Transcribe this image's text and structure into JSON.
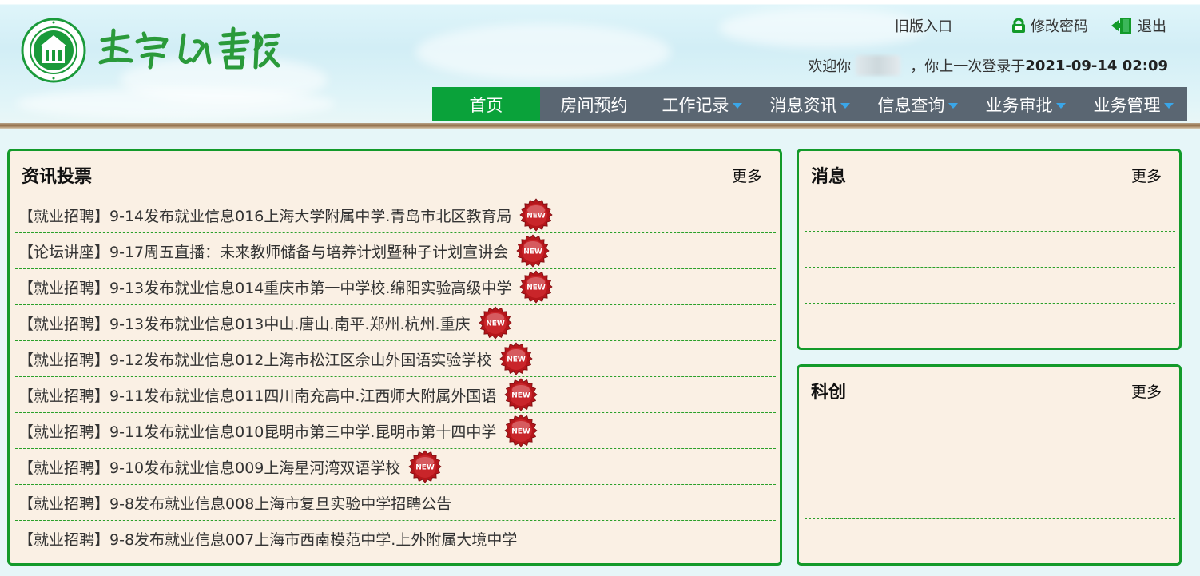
{
  "header": {
    "logo_emblem_text": "SHANGHAI NORMAL UNIVERSITY",
    "logo_title": "敬業樂群書院",
    "old_entry": "旧版入口",
    "change_password": "修改密码",
    "logout": "退出",
    "welcome_prefix": "欢迎你",
    "welcome_middle": "，你上一次登录于",
    "last_login": "2021-09-14 02:09"
  },
  "nav": {
    "items": [
      {
        "label": "首页",
        "active": true,
        "dropdown": false
      },
      {
        "label": "房间预约",
        "active": false,
        "dropdown": false
      },
      {
        "label": "工作记录",
        "active": false,
        "dropdown": true
      },
      {
        "label": "消息资讯",
        "active": false,
        "dropdown": true
      },
      {
        "label": "信息查询",
        "active": false,
        "dropdown": true
      },
      {
        "label": "业务审批",
        "active": false,
        "dropdown": true
      },
      {
        "label": "业务管理",
        "active": false,
        "dropdown": true
      }
    ]
  },
  "news_panel": {
    "title": "资讯投票",
    "more": "更多",
    "items": [
      {
        "text": "【就业招聘】9-14发布就业信息016上海大学附属中学.青岛市北区教育局",
        "is_new": true
      },
      {
        "text": "【论坛讲座】9-17周五直播：未来教师储备与培养计划暨种子计划宣讲会",
        "is_new": true
      },
      {
        "text": "【就业招聘】9-13发布就业信息014重庆市第一中学校.绵阳实验高级中学",
        "is_new": true
      },
      {
        "text": "【就业招聘】9-13发布就业信息013中山.唐山.南平.郑州.杭州.重庆",
        "is_new": true
      },
      {
        "text": "【就业招聘】9-12发布就业信息012上海市松江区佘山外国语实验学校",
        "is_new": true
      },
      {
        "text": "【就业招聘】9-11发布就业信息011四川南充高中.江西师大附属外国语",
        "is_new": true
      },
      {
        "text": "【就业招聘】9-11发布就业信息010昆明市第三中学.昆明市第十四中学",
        "is_new": true
      },
      {
        "text": "【就业招聘】9-10发布就业信息009上海星河湾双语学校",
        "is_new": true
      },
      {
        "text": "【就业招聘】9-8发布就业信息008上海市复旦实验中学招聘公告",
        "is_new": false
      },
      {
        "text": "【就业招聘】9-8发布就业信息007上海市西南模范中学.上外附属大境中学",
        "is_new": false
      }
    ],
    "badge_text": "NEW"
  },
  "message_panel": {
    "title": "消息",
    "more": "更多"
  },
  "innovation_panel": {
    "title": "科创",
    "more": "更多"
  },
  "colors": {
    "nav_bg": "#5a6672",
    "nav_active": "#0aa23a",
    "panel_border": "#139a2a",
    "panel_bg": "#faf0e4",
    "badge_red": "#b5161b"
  }
}
